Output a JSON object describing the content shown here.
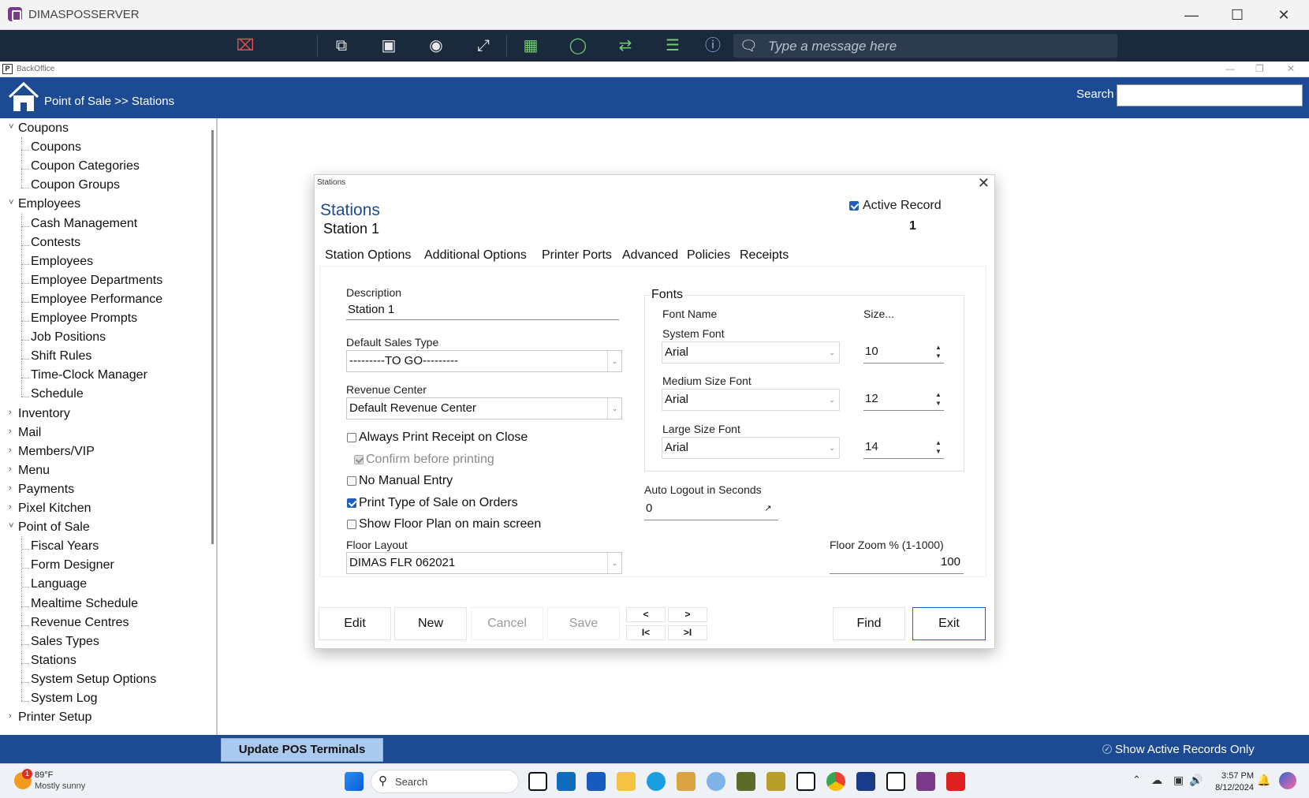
{
  "window": {
    "title": "DIMASPOSSERVER"
  },
  "remote_toolbar": {
    "message_placeholder": "Type a message here"
  },
  "backoffice": {
    "title": "BackOffice",
    "icon_letter": "P"
  },
  "header": {
    "breadcrumb": "Point of Sale >> Stations",
    "search_label": "Search",
    "search_value": ""
  },
  "sidebar": {
    "items": [
      {
        "label": "Coupons",
        "level": 0,
        "expanded": true
      },
      {
        "label": "Coupons",
        "level": 1
      },
      {
        "label": "Coupon Categories",
        "level": 1
      },
      {
        "label": "Coupon Groups",
        "level": 1
      },
      {
        "label": "Employees",
        "level": 0,
        "expanded": true
      },
      {
        "label": "Cash Management",
        "level": 1
      },
      {
        "label": "Contests",
        "level": 1
      },
      {
        "label": "Employees",
        "level": 1
      },
      {
        "label": "Employee Departments",
        "level": 1
      },
      {
        "label": "Employee Performance",
        "level": 1
      },
      {
        "label": "Employee Prompts",
        "level": 1
      },
      {
        "label": "Job Positions",
        "level": 1
      },
      {
        "label": "Shift Rules",
        "level": 1
      },
      {
        "label": "Time-Clock Manager",
        "level": 1
      },
      {
        "label": "Schedule",
        "level": 1
      },
      {
        "label": "Inventory",
        "level": 0,
        "expanded": false
      },
      {
        "label": "Mail",
        "level": 0,
        "expanded": false
      },
      {
        "label": "Members/VIP",
        "level": 0,
        "expanded": false
      },
      {
        "label": "Menu",
        "level": 0,
        "expanded": false
      },
      {
        "label": "Payments",
        "level": 0,
        "expanded": false
      },
      {
        "label": "Pixel Kitchen",
        "level": 0,
        "expanded": false
      },
      {
        "label": "Point of Sale",
        "level": 0,
        "expanded": true
      },
      {
        "label": "Fiscal Years",
        "level": 1
      },
      {
        "label": "Form Designer",
        "level": 1
      },
      {
        "label": "Language",
        "level": 1
      },
      {
        "label": "Mealtime Schedule",
        "level": 1
      },
      {
        "label": "Revenue Centres",
        "level": 1
      },
      {
        "label": "Sales Types",
        "level": 1
      },
      {
        "label": "Stations",
        "level": 1
      },
      {
        "label": "System Setup Options",
        "level": 1
      },
      {
        "label": "System Log",
        "level": 1
      },
      {
        "label": "Printer Setup",
        "level": 0,
        "expanded": false
      }
    ]
  },
  "dialog": {
    "window_title": "Stations",
    "heading": "Stations",
    "subheading": "Station 1",
    "active_record_label": "Active Record",
    "active_record_checked": true,
    "record_number": "1",
    "tabs": [
      "Station Options",
      "Additional Options",
      "Printer Ports",
      "Advanced",
      "Policies",
      "Receipts"
    ],
    "active_tab": "Station Options",
    "description_label": "Description",
    "description_value": "Station 1",
    "sales_type_label": "Default Sales Type",
    "sales_type_value": "---------TO GO---------",
    "revenue_center_label": "Revenue Center",
    "revenue_center_value": "Default Revenue Center",
    "options": [
      {
        "label": "Always Print Receipt on Close",
        "checked": false,
        "disabled": false
      },
      {
        "label": "Confirm before printing",
        "checked": true,
        "disabled": true
      },
      {
        "label": "No Manual Entry",
        "checked": false,
        "disabled": false
      },
      {
        "label": "Print Type of Sale on Orders",
        "checked": true,
        "disabled": false
      },
      {
        "label": "Show Floor Plan on main screen",
        "checked": false,
        "disabled": false
      }
    ],
    "floor_layout_label": "Floor Layout",
    "floor_layout_value": "DIMAS FLR 062021",
    "fonts": {
      "group_label": "Fonts",
      "name_header": "Font Name",
      "size_header": "Size...",
      "rows": [
        {
          "label": "System Font",
          "font": "Arial",
          "size": "10"
        },
        {
          "label": "Medium Size Font",
          "font": "Arial",
          "size": "12"
        },
        {
          "label": "Large Size Font",
          "font": "Arial",
          "size": "14"
        }
      ]
    },
    "auto_logout_label": "Auto Logout in Seconds",
    "auto_logout_value": "0",
    "floor_zoom_label": "Floor Zoom % (1-1000)",
    "floor_zoom_value": "100",
    "buttons": {
      "edit": "Edit",
      "new": "New",
      "cancel": "Cancel",
      "save": "Save",
      "find": "Find",
      "exit": "Exit"
    },
    "nav": {
      "prev": "<",
      "next": ">",
      "first": "I<",
      "last": ">I"
    }
  },
  "bottom": {
    "update_button": "Update POS Terminals",
    "show_active_label": "Show Active Records Only",
    "show_active_checked": true
  },
  "taskbar": {
    "weather_temp": "89°F",
    "weather_cond": "Mostly sunny",
    "weather_badge": "1",
    "search_placeholder": "Search",
    "time": "3:57 PM",
    "date": "8/12/2024"
  },
  "colors": {
    "header": "#1c4a93",
    "accent": "#1f5fbf",
    "toolbar": "#1a2a3c",
    "update_button": "#a9c9ef"
  }
}
